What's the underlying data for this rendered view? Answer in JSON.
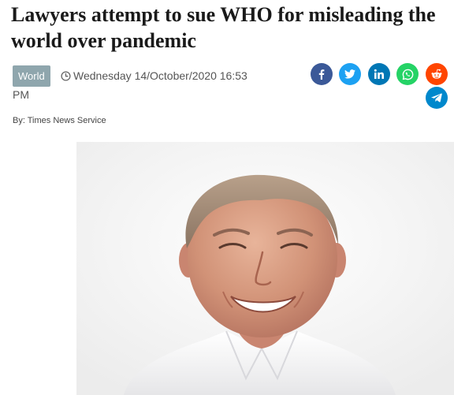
{
  "article": {
    "headline": "Lawyers attempt to sue WHO for misleading the world over pandemic",
    "category": "World",
    "date_main": "Wednesday 14/October/2020 16:53",
    "date_suffix": "PM",
    "byline": "By: Times News Service"
  },
  "share_buttons": [
    {
      "network": "facebook",
      "icon": "facebook-icon",
      "color": "#3b5998"
    },
    {
      "network": "twitter",
      "icon": "twitter-icon",
      "color": "#1da1f2"
    },
    {
      "network": "linkedin",
      "icon": "linkedin-icon",
      "color": "#0077b5"
    },
    {
      "network": "whatsapp",
      "icon": "whatsapp-icon",
      "color": "#25d366"
    },
    {
      "network": "reddit",
      "icon": "reddit-icon",
      "color": "#ff4500"
    },
    {
      "network": "telegram",
      "icon": "telegram-icon",
      "color": "#0088cc"
    }
  ],
  "image": {
    "subject": "portrait-photo"
  }
}
